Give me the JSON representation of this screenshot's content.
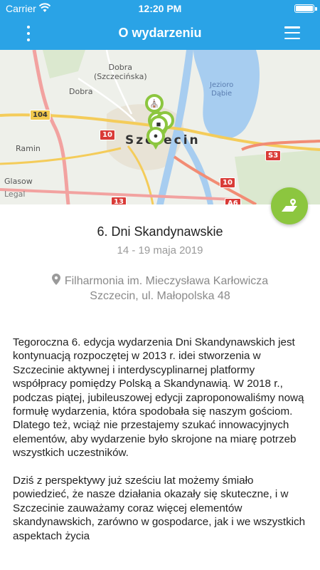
{
  "status_bar": {
    "carrier": "Carrier",
    "time": "12:20 PM"
  },
  "nav": {
    "title": "O wydarzeniu"
  },
  "map": {
    "labels": {
      "dobra_szczecinska": "Dobra\n(Szczecińska)",
      "dobra": "Dobra",
      "ramin": "Ramin",
      "glasow": "Glasow",
      "legal": "Legal",
      "city": "Szczecin",
      "lake": "Jezioro\nDąbie"
    },
    "roads": {
      "r104": "104",
      "r10a": "10",
      "r10b": "10",
      "r13": "13",
      "s3": "S3",
      "a6": "A6"
    }
  },
  "event": {
    "title": "6. Dni Skandynawskie",
    "date": "14 - 19 maja 2019",
    "venue_name": "Filharmonia im. Mieczysława Karłowicza",
    "venue_address": "Szczecin, ul. Małopolska 48"
  },
  "description": {
    "p1": "Tegoroczna 6. edycja wydarzenia Dni Skandynawskich jest kontynuacją rozpoczętej w 2013 r. idei stworzenia w Szczecinie aktywnej i interdyscyplinarnej platformy współpracy pomiędzy Polską a Skandynawią. W 2018 r., podczas piątej, jubileuszowej edycji zaproponowaliśmy nową formułę wydarzenia, która spodobała się naszym gościom. Dlatego też, wciąż nie przestajemy szukać innowacyjnych elementów, aby wydarzenie było skrojone na miarę potrzeb wszystkich uczestników.",
    "p2": "Dziś z perspektywy już sześciu lat możemy śmiało powiedzieć, że nasze działania okazały się skuteczne, i w Szczecinie zauważamy coraz więcej elementów skandynawskich,  zarówno w gospodarce, jak i we wszystkich aspektach życia"
  },
  "colors": {
    "header": "#2aa3e6",
    "accent_green": "#8cc63f"
  }
}
